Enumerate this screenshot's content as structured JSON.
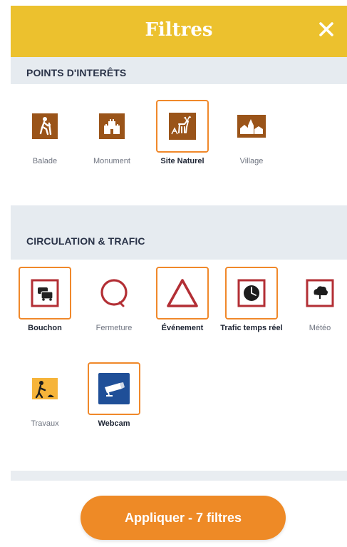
{
  "header": {
    "title": "Filtres"
  },
  "sections": [
    {
      "title": "POINTS D'INTERÊTS",
      "items": [
        {
          "label": "Balade",
          "icon": "hiker-icon",
          "selected": false
        },
        {
          "label": "Monument",
          "icon": "castle-icon",
          "selected": false
        },
        {
          "label": "Site Naturel",
          "icon": "deer-icon",
          "selected": true
        },
        {
          "label": "Village",
          "icon": "village-icon",
          "selected": false
        }
      ]
    },
    {
      "title": "CIRCULATION & TRAFIC",
      "items": [
        {
          "label": "Bouchon",
          "icon": "traffic-jam-icon",
          "selected": true
        },
        {
          "label": "Fermeture",
          "icon": "closure-circle-icon",
          "selected": false
        },
        {
          "label": "Événement",
          "icon": "warning-triangle-icon",
          "selected": true
        },
        {
          "label": "Trafic temps réel",
          "icon": "clock-icon",
          "selected": true
        },
        {
          "label": "Météo",
          "icon": "cloud-icon",
          "selected": false
        },
        {
          "label": "Travaux",
          "icon": "roadworks-icon",
          "selected": false
        },
        {
          "label": "Webcam",
          "icon": "webcam-icon",
          "selected": true
        }
      ]
    }
  ],
  "footer": {
    "apply_label": "Appliquer - 7 filtres"
  },
  "colors": {
    "header": "#ecc12e",
    "accent": "#ee8a26",
    "poi_icon_brown": "#9a5419",
    "traffic_red": "#b32f35",
    "webcam_blue": "#1f4f98"
  }
}
